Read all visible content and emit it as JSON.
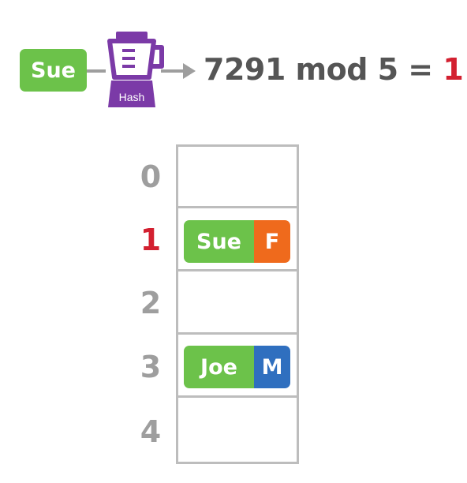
{
  "colors": {
    "green": "#6cc24a",
    "purple": "#7b3aa7",
    "orange": "#ef6a1c",
    "blue": "#2f6fbf",
    "red": "#d32030",
    "gray": "#9e9e9e"
  },
  "input": {
    "key": "Sue",
    "icon": "blender-icon",
    "hash_label": "Hash"
  },
  "equation": {
    "expr": "7291 mod 5 = ",
    "result": "1"
  },
  "table": {
    "indices": [
      "0",
      "1",
      "2",
      "3",
      "4"
    ],
    "highlighted_index": "1",
    "entries": [
      {
        "slot": "1",
        "key": "Sue",
        "value": "F"
      },
      {
        "slot": "3",
        "key": "Joe",
        "value": "M"
      }
    ]
  }
}
